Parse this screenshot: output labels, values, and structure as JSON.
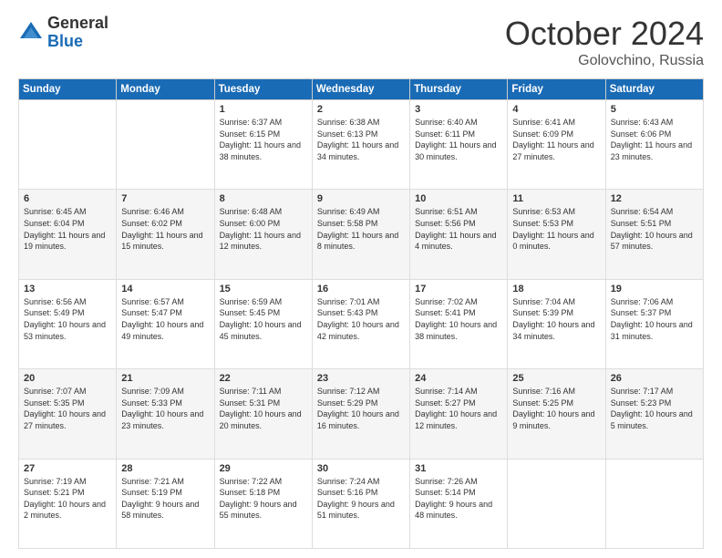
{
  "header": {
    "logo_general": "General",
    "logo_blue": "Blue",
    "month_title": "October 2024",
    "location": "Golovchino, Russia"
  },
  "days_of_week": [
    "Sunday",
    "Monday",
    "Tuesday",
    "Wednesday",
    "Thursday",
    "Friday",
    "Saturday"
  ],
  "weeks": [
    [
      {
        "day": "",
        "info": ""
      },
      {
        "day": "",
        "info": ""
      },
      {
        "day": "1",
        "info": "Sunrise: 6:37 AM\nSunset: 6:15 PM\nDaylight: 11 hours and 38 minutes."
      },
      {
        "day": "2",
        "info": "Sunrise: 6:38 AM\nSunset: 6:13 PM\nDaylight: 11 hours and 34 minutes."
      },
      {
        "day": "3",
        "info": "Sunrise: 6:40 AM\nSunset: 6:11 PM\nDaylight: 11 hours and 30 minutes."
      },
      {
        "day": "4",
        "info": "Sunrise: 6:41 AM\nSunset: 6:09 PM\nDaylight: 11 hours and 27 minutes."
      },
      {
        "day": "5",
        "info": "Sunrise: 6:43 AM\nSunset: 6:06 PM\nDaylight: 11 hours and 23 minutes."
      }
    ],
    [
      {
        "day": "6",
        "info": "Sunrise: 6:45 AM\nSunset: 6:04 PM\nDaylight: 11 hours and 19 minutes."
      },
      {
        "day": "7",
        "info": "Sunrise: 6:46 AM\nSunset: 6:02 PM\nDaylight: 11 hours and 15 minutes."
      },
      {
        "day": "8",
        "info": "Sunrise: 6:48 AM\nSunset: 6:00 PM\nDaylight: 11 hours and 12 minutes."
      },
      {
        "day": "9",
        "info": "Sunrise: 6:49 AM\nSunset: 5:58 PM\nDaylight: 11 hours and 8 minutes."
      },
      {
        "day": "10",
        "info": "Sunrise: 6:51 AM\nSunset: 5:56 PM\nDaylight: 11 hours and 4 minutes."
      },
      {
        "day": "11",
        "info": "Sunrise: 6:53 AM\nSunset: 5:53 PM\nDaylight: 11 hours and 0 minutes."
      },
      {
        "day": "12",
        "info": "Sunrise: 6:54 AM\nSunset: 5:51 PM\nDaylight: 10 hours and 57 minutes."
      }
    ],
    [
      {
        "day": "13",
        "info": "Sunrise: 6:56 AM\nSunset: 5:49 PM\nDaylight: 10 hours and 53 minutes."
      },
      {
        "day": "14",
        "info": "Sunrise: 6:57 AM\nSunset: 5:47 PM\nDaylight: 10 hours and 49 minutes."
      },
      {
        "day": "15",
        "info": "Sunrise: 6:59 AM\nSunset: 5:45 PM\nDaylight: 10 hours and 45 minutes."
      },
      {
        "day": "16",
        "info": "Sunrise: 7:01 AM\nSunset: 5:43 PM\nDaylight: 10 hours and 42 minutes."
      },
      {
        "day": "17",
        "info": "Sunrise: 7:02 AM\nSunset: 5:41 PM\nDaylight: 10 hours and 38 minutes."
      },
      {
        "day": "18",
        "info": "Sunrise: 7:04 AM\nSunset: 5:39 PM\nDaylight: 10 hours and 34 minutes."
      },
      {
        "day": "19",
        "info": "Sunrise: 7:06 AM\nSunset: 5:37 PM\nDaylight: 10 hours and 31 minutes."
      }
    ],
    [
      {
        "day": "20",
        "info": "Sunrise: 7:07 AM\nSunset: 5:35 PM\nDaylight: 10 hours and 27 minutes."
      },
      {
        "day": "21",
        "info": "Sunrise: 7:09 AM\nSunset: 5:33 PM\nDaylight: 10 hours and 23 minutes."
      },
      {
        "day": "22",
        "info": "Sunrise: 7:11 AM\nSunset: 5:31 PM\nDaylight: 10 hours and 20 minutes."
      },
      {
        "day": "23",
        "info": "Sunrise: 7:12 AM\nSunset: 5:29 PM\nDaylight: 10 hours and 16 minutes."
      },
      {
        "day": "24",
        "info": "Sunrise: 7:14 AM\nSunset: 5:27 PM\nDaylight: 10 hours and 12 minutes."
      },
      {
        "day": "25",
        "info": "Sunrise: 7:16 AM\nSunset: 5:25 PM\nDaylight: 10 hours and 9 minutes."
      },
      {
        "day": "26",
        "info": "Sunrise: 7:17 AM\nSunset: 5:23 PM\nDaylight: 10 hours and 5 minutes."
      }
    ],
    [
      {
        "day": "27",
        "info": "Sunrise: 7:19 AM\nSunset: 5:21 PM\nDaylight: 10 hours and 2 minutes."
      },
      {
        "day": "28",
        "info": "Sunrise: 7:21 AM\nSunset: 5:19 PM\nDaylight: 9 hours and 58 minutes."
      },
      {
        "day": "29",
        "info": "Sunrise: 7:22 AM\nSunset: 5:18 PM\nDaylight: 9 hours and 55 minutes."
      },
      {
        "day": "30",
        "info": "Sunrise: 7:24 AM\nSunset: 5:16 PM\nDaylight: 9 hours and 51 minutes."
      },
      {
        "day": "31",
        "info": "Sunrise: 7:26 AM\nSunset: 5:14 PM\nDaylight: 9 hours and 48 minutes."
      },
      {
        "day": "",
        "info": ""
      },
      {
        "day": "",
        "info": ""
      }
    ]
  ]
}
